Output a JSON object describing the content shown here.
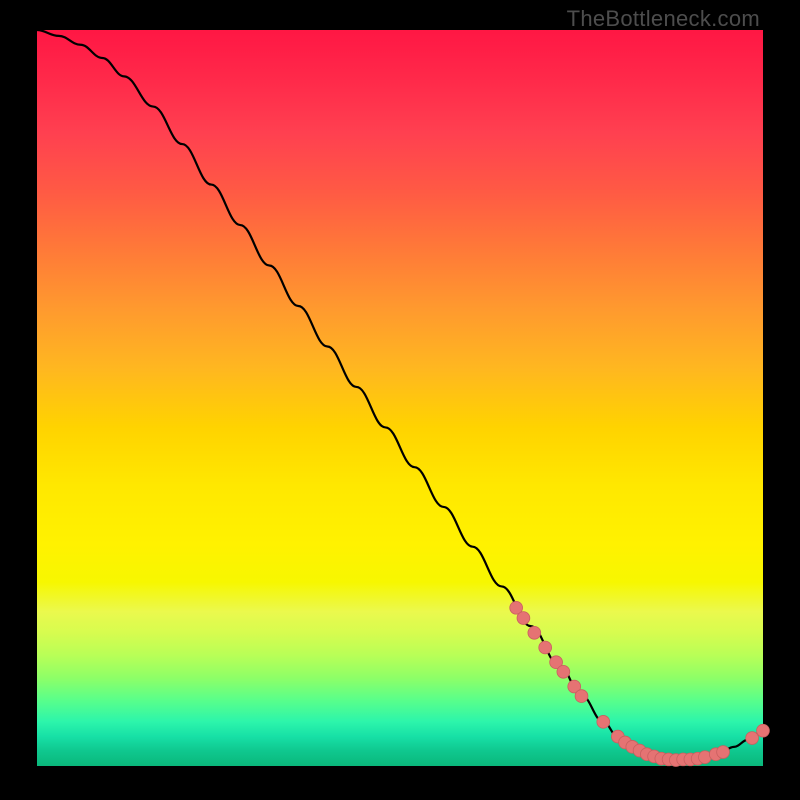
{
  "watermark": "TheBottleneck.com",
  "colors": {
    "background": "#000000",
    "line": "#000000",
    "marker": "#e57373",
    "marker_stroke": "#c95f5f"
  },
  "chart_data": {
    "type": "line",
    "title": "",
    "xlabel": "",
    "ylabel": "",
    "xlim": [
      0,
      100
    ],
    "ylim": [
      0,
      100
    ],
    "x": [
      0,
      3,
      6,
      9,
      12,
      16,
      20,
      24,
      28,
      32,
      36,
      40,
      44,
      48,
      52,
      56,
      60,
      64,
      68,
      72,
      75,
      78,
      80,
      82,
      84,
      86,
      88,
      90,
      92,
      94,
      96,
      98,
      100
    ],
    "values": [
      100,
      99.2,
      98.0,
      96.2,
      93.7,
      89.6,
      84.5,
      79.0,
      73.5,
      68.0,
      62.5,
      57.0,
      51.5,
      46.0,
      40.6,
      35.2,
      29.8,
      24.4,
      19.0,
      13.6,
      9.6,
      6.0,
      4.0,
      2.6,
      1.6,
      1.0,
      0.8,
      0.9,
      1.2,
      1.8,
      2.6,
      3.6,
      4.8
    ],
    "markers_x": [
      66,
      67,
      68.5,
      70,
      71.5,
      72.5,
      74,
      75,
      78,
      80,
      81,
      82,
      83,
      84,
      85,
      86,
      87,
      88,
      89,
      90,
      91,
      92,
      93.5,
      94.5,
      98.5,
      100
    ],
    "markers_y": [
      21.5,
      20.1,
      18.1,
      16.1,
      14.1,
      12.8,
      10.8,
      9.5,
      6.0,
      4.0,
      3.2,
      2.6,
      2.1,
      1.6,
      1.3,
      1.0,
      0.9,
      0.8,
      0.9,
      0.9,
      1.0,
      1.2,
      1.6,
      1.9,
      3.8,
      4.8
    ]
  }
}
